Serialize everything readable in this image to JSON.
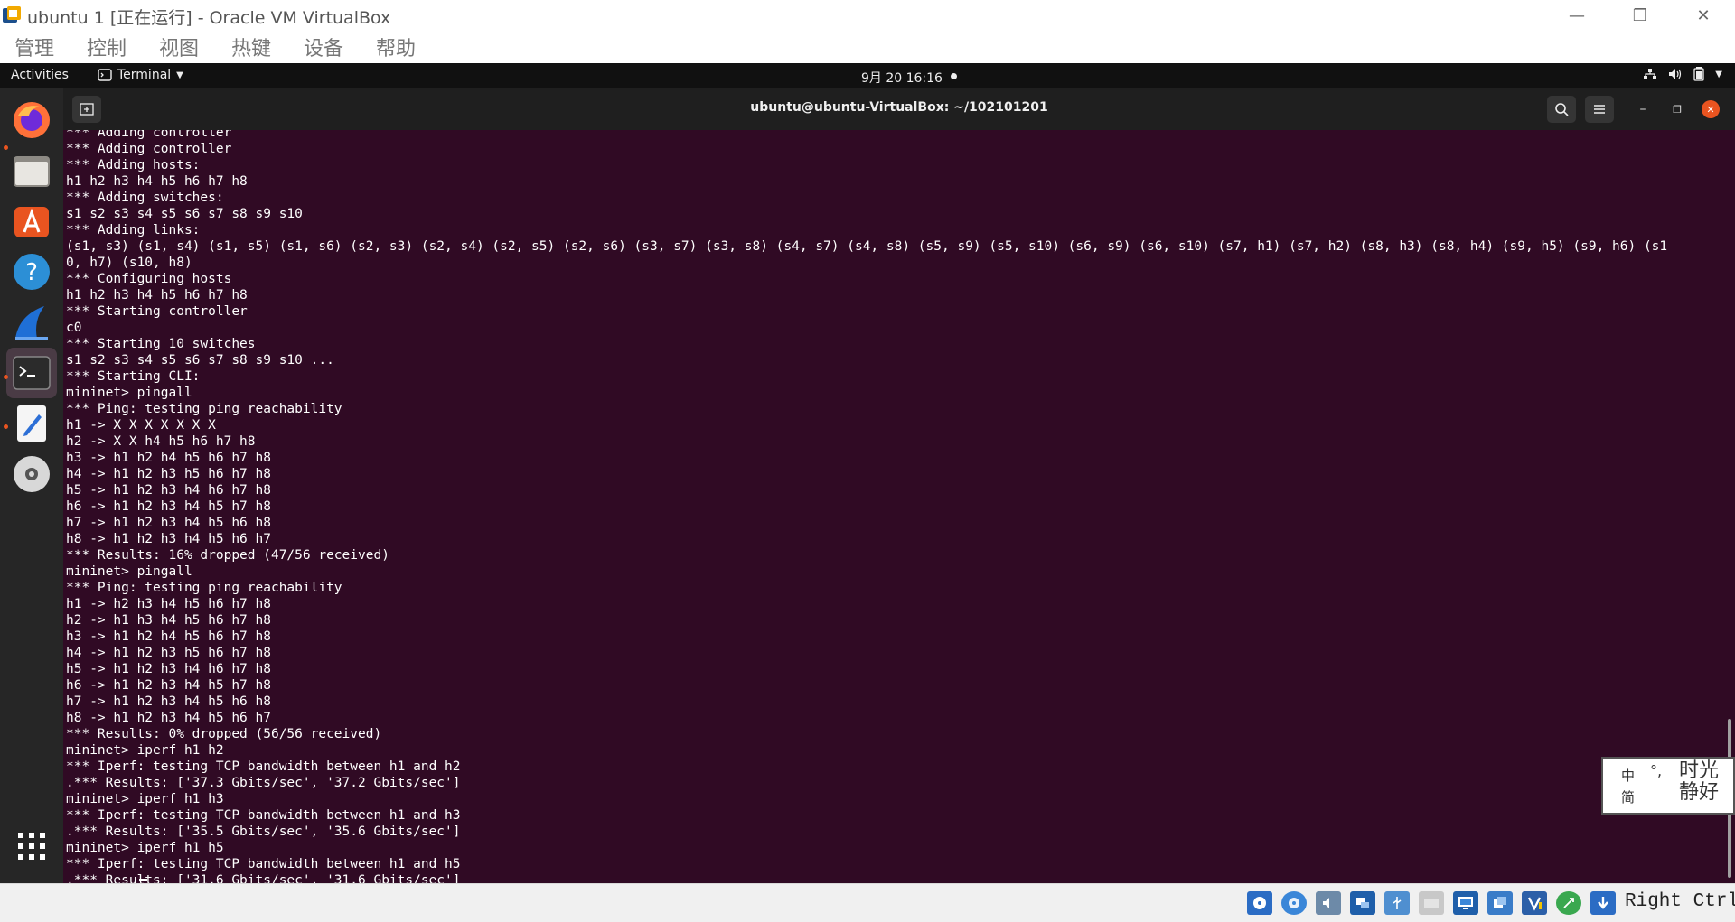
{
  "vbox": {
    "title": "ubuntu 1 [正在运行] - Oracle VM VirtualBox",
    "menu": [
      "管理",
      "控制",
      "视图",
      "热键",
      "设备",
      "帮助"
    ],
    "host_key": "Right Ctrl"
  },
  "topbar": {
    "activities": "Activities",
    "app_name": "Terminal",
    "clock": "9月 20  16:16"
  },
  "dock": {
    "items": [
      "firefox-icon",
      "files-icon",
      "software-icon",
      "help-icon",
      "wireshark-icon",
      "terminal-icon",
      "text-editor-icon",
      "disc-icon",
      "show-apps-icon"
    ]
  },
  "terminal": {
    "title": "ubuntu@ubuntu-VirtualBox: ~/102101201",
    "output": "*** Adding controller\n*** Adding controller\n*** Adding hosts:\nh1 h2 h3 h4 h5 h6 h7 h8\n*** Adding switches:\ns1 s2 s3 s4 s5 s6 s7 s8 s9 s10\n*** Adding links:\n(s1, s3) (s1, s4) (s1, s5) (s1, s6) (s2, s3) (s2, s4) (s2, s5) (s2, s6) (s3, s7) (s3, s8) (s4, s7) (s4, s8) (s5, s9) (s5, s10) (s6, s9) (s6, s10) (s7, h1) (s7, h2) (s8, h3) (s8, h4) (s9, h5) (s9, h6) (s1\n0, h7) (s10, h8)\n*** Configuring hosts\nh1 h2 h3 h4 h5 h6 h7 h8\n*** Starting controller\nc0\n*** Starting 10 switches\ns1 s2 s3 s4 s5 s6 s7 s8 s9 s10 ...\n*** Starting CLI:\nmininet> pingall\n*** Ping: testing ping reachability\nh1 -> X X X X X X X\nh2 -> X X h4 h5 h6 h7 h8\nh3 -> h1 h2 h4 h5 h6 h7 h8\nh4 -> h1 h2 h3 h5 h6 h7 h8\nh5 -> h1 h2 h3 h4 h6 h7 h8\nh6 -> h1 h2 h3 h4 h5 h7 h8\nh7 -> h1 h2 h3 h4 h5 h6 h8\nh8 -> h1 h2 h3 h4 h5 h6 h7\n*** Results: 16% dropped (47/56 received)\nmininet> pingall\n*** Ping: testing ping reachability\nh1 -> h2 h3 h4 h5 h6 h7 h8\nh2 -> h1 h3 h4 h5 h6 h7 h8\nh3 -> h1 h2 h4 h5 h6 h7 h8\nh4 -> h1 h2 h3 h5 h6 h7 h8\nh5 -> h1 h2 h3 h4 h6 h7 h8\nh6 -> h1 h2 h3 h4 h5 h7 h8\nh7 -> h1 h2 h3 h4 h5 h6 h8\nh8 -> h1 h2 h3 h4 h5 h6 h7\n*** Results: 0% dropped (56/56 received)\nmininet> iperf h1 h2\n*** Iperf: testing TCP bandwidth between h1 and h2\n.*** Results: ['37.3 Gbits/sec', '37.2 Gbits/sec']\nmininet> iperf h1 h3\n*** Iperf: testing TCP bandwidth between h1 and h3\n.*** Results: ['35.5 Gbits/sec', '35.6 Gbits/sec']\nmininet> iperf h1 h5\n*** Iperf: testing TCP bandwidth between h1 and h5\n.*** Results: ['31.6 Gbits/sec', '31.6 Gbits/sec']"
  },
  "ime": {
    "mode_char": "中",
    "charset_char": "简",
    "punct_char": "°,",
    "stamp_top": "时光",
    "stamp_bottom": "静好"
  },
  "colors": {
    "terminal_bg": "#300a24",
    "accent": "#e95420",
    "dock_bg": "#262626"
  }
}
